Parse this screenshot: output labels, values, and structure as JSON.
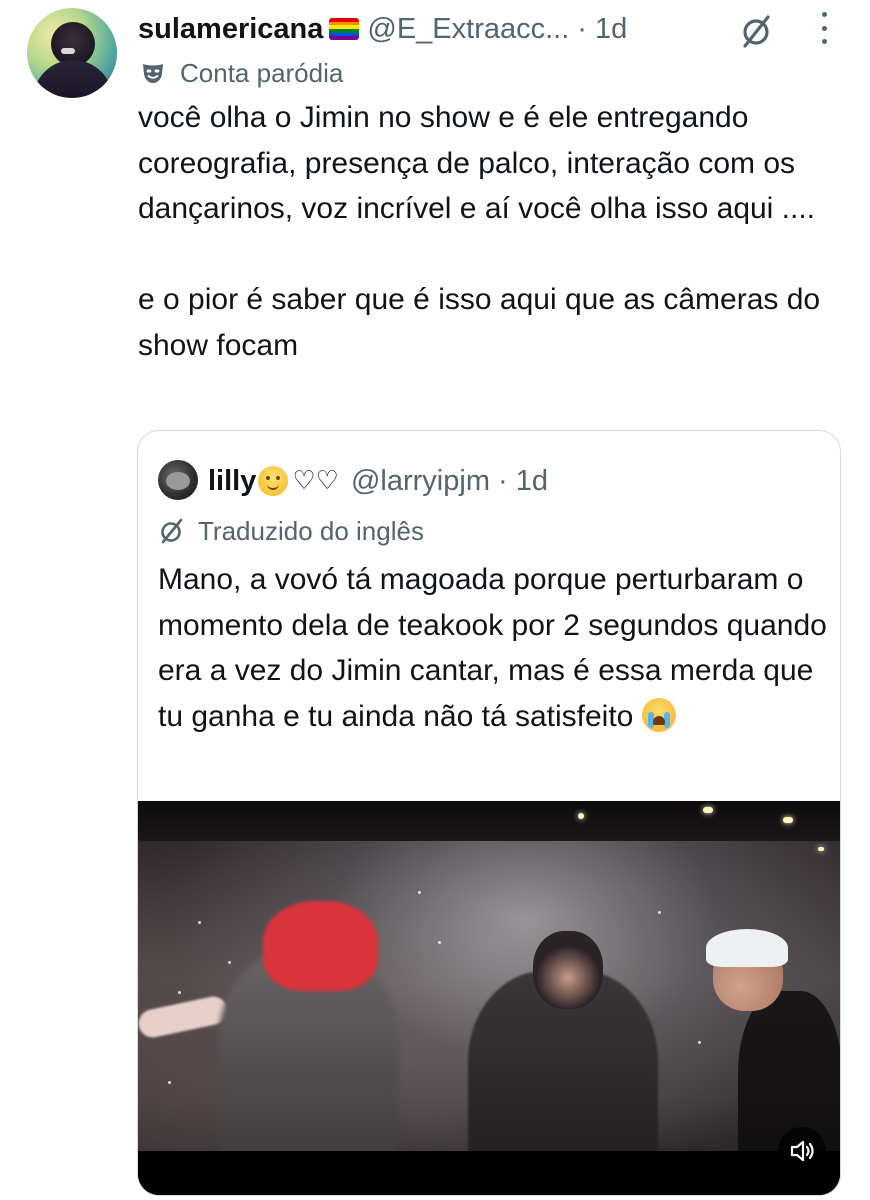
{
  "post": {
    "author": {
      "display_name": "sulamericana",
      "flag_emoji": "🏳️‍🌈",
      "handle": "@E_Extraacc...",
      "time": "· 1d",
      "avatar_icon": "profile-photo"
    },
    "parody_label": "Conta paródia",
    "text": "você olha o Jimin no show e é ele entregando coreografia, presença de palco, interação com os dançarinos, voz incrível e aí você olha isso aqui ....\n\ne o pior é saber que é isso aqui que as câmeras do show focam",
    "icons": [
      "grok-icon",
      "more-icon",
      "parody-mask-icon"
    ]
  },
  "quoted": {
    "author": {
      "display_name": "lilly",
      "emoji": "🫠",
      "hearts": "♡♡",
      "handle": "@larryipjm",
      "time": "· 1d"
    },
    "translation_label": "Traduzido do inglês",
    "text": "Mano, a vovó tá magoada porque perturbaram o momento dela de teakook por 2 segundos quando era a vez do Jimin cantar, mas é essa merda que tu ganha e tu ainda não tá satisfeito",
    "trailing_emoji": "😭",
    "media": {
      "type": "video",
      "mute_icon": "speaker-muted-icon"
    }
  },
  "colors": {
    "text_primary": "#0f1419",
    "text_secondary": "#536471",
    "border": "#cfd9de"
  }
}
